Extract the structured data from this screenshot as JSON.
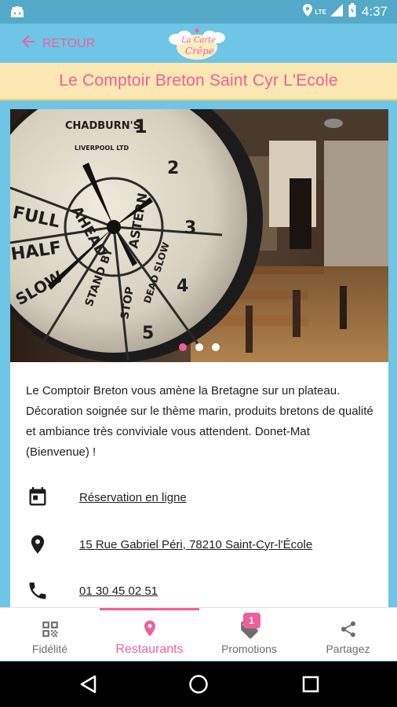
{
  "status_bar": {
    "time": "4:37",
    "network": "LTE",
    "icons": [
      "android-icon",
      "location-icon",
      "signal-icon",
      "battery-icon"
    ]
  },
  "app_bar": {
    "back_label": "RETOUR",
    "logo_text_line1": "La Carte",
    "logo_text_line2": "Crêpe"
  },
  "restaurant": {
    "name": "Le Comptoir Breton Saint Cyr L'Ecole",
    "description": "Le Comptoir Breton vous amène la Bretagne sur un plateau. Décoration soignée sur le thème marin, produits bretons de qualité et ambiance très conviviale vous attendent. Donet-Mat (Bienvenue) !",
    "reservation": "Réservation en ligne",
    "address": "15 Rue Gabriel Péri, 78210 Saint-Cyr-l'École",
    "phone": "01 30 45 02 51",
    "photo": {
      "total": 3,
      "active_index": 0
    },
    "clock_texts": {
      "brand": "CHADBURN'S",
      "maker": "LIVERPOOL LTD",
      "numbers": [
        "1",
        "2",
        "3",
        "4",
        "5"
      ],
      "words": [
        "FULL",
        "HALF",
        "SLOW",
        "AHEAD",
        "STAND BY",
        "STOP",
        "DEAD SLOW",
        "ASTERN"
      ]
    }
  },
  "bottom_nav": {
    "items": [
      {
        "label": "Fidélité",
        "icon": "qr-code-icon"
      },
      {
        "label": "Restaurants",
        "icon": "map-pin-icon"
      },
      {
        "label": "Promotions",
        "icon": "tag-icon",
        "badge": "1"
      },
      {
        "label": "Partagez",
        "icon": "share-icon"
      }
    ],
    "active": "Restaurants"
  },
  "colors": {
    "accent": "#ef5f9c",
    "header": "#6ec5e6",
    "status_bar": "#53a9c7",
    "title_bg": "#fbe7b2"
  }
}
